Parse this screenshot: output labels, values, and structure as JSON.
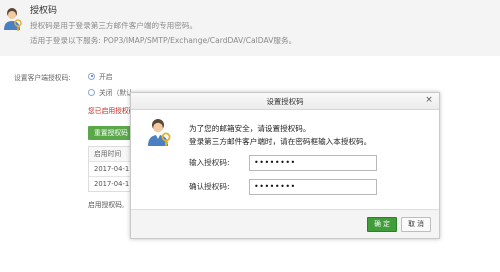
{
  "page": {
    "title": "授权码",
    "desc_line1": "授权码是用于登录第三方邮件客户端的专用密码。",
    "desc_line2": "适用于登录以下服务: POP3/IMAP/SMTP/Exchange/CardDAV/CalDAV服务。"
  },
  "settings": {
    "label": "设置客户端授权码:",
    "option_on": "开启",
    "option_off": "关闭（默认",
    "warning": "您已启用授权码",
    "generate_button": "重置授权码",
    "table": {
      "header": "启用时间",
      "rows": [
        "2017-04-1",
        "2017-04-1"
      ]
    },
    "bottom_note": "启用授权码,"
  },
  "dialog": {
    "title": "设置授权码",
    "message_line1": "为了您的邮箱安全，请设置授权码。",
    "message_line2": "登录第三方邮件客户端时，请在密码框输入本授权码。",
    "label_input": "输入授权码:",
    "label_confirm": "确认授权码:",
    "input_value": "••••••••",
    "confirm_value": "••••••••",
    "ok_label": "确 定",
    "cancel_label": "取 消",
    "close_glyph": "×"
  },
  "colors": {
    "accent_green": "#3f9d3a",
    "warning_red": "#c8261a"
  }
}
